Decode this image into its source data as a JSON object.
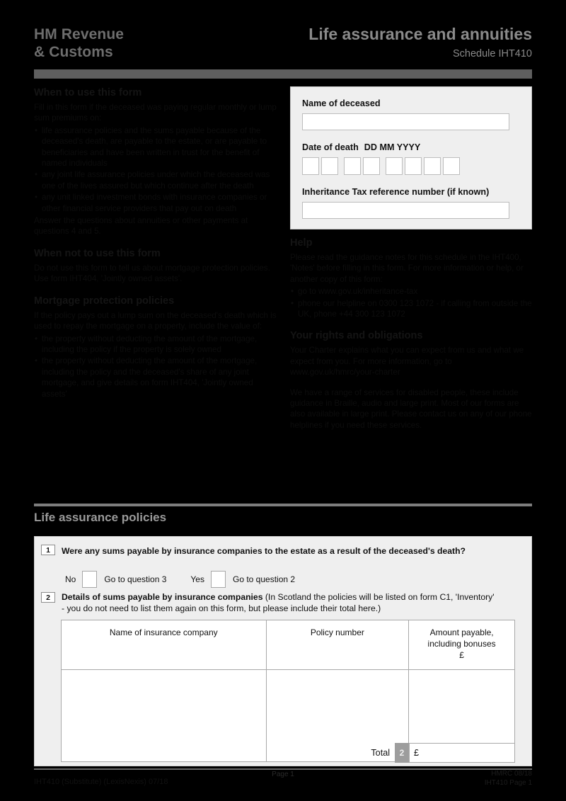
{
  "header": {
    "brand_line1": "HM Revenue",
    "brand_line2": "& Customs",
    "title": "Life assurance and annuities",
    "schedule": "Schedule IHT410"
  },
  "left_column": {
    "when_to_use": {
      "heading": "When to use this form",
      "intro": "Fill in this form if the deceased was paying regular monthly or lump sum premiums on:",
      "bullets": [
        "life assurance policies and the sums payable because of the deceased's death, are payable to the estate, or are payable to beneficiaries and have been written in trust for the benefit of named individuals",
        "any joint life assurance policies under which the deceased was one of the lives assured but which continue after the death",
        "any unit linked investment bonds with insurance companies or other financial service providers that pay out on death"
      ],
      "closing": "Answer the questions about annuities or other payments at questions 4 and 5."
    },
    "when_not_to_use": {
      "heading": "When not to use this form",
      "text": "Do not use this form to tell us about mortgage protection policies. Use form IHT404, 'Jointly owned assets'."
    },
    "mortgage": {
      "heading": "Mortgage protection policies",
      "intro": "If the policy pays out a lump sum on the deceased's death which is used to repay the mortgage on a property, include the value of:",
      "bullets": [
        "the property without deducting the amount of the mortgage, including the policy if the property is solely owned",
        "the property without deducting the amount of the mortgage, including the policy and the deceased's share of any joint mortgage, and give details on form IHT404, 'Jointly owned assets'"
      ]
    }
  },
  "right_column": {
    "help": {
      "heading": "Help",
      "intro": "Please read the guidance notes for this schedule in the IHT400, 'Notes' before filling in this form. For more information or help, or another copy of this form:",
      "bullets": [
        "go to www.gov.uk/inheritance-tax",
        "phone our helpline on 0300 123 1072 - if calling from outside the UK, phone +44 300 123 1072"
      ]
    },
    "rights": {
      "heading": "Your rights and obligations",
      "text": "Your Charter explains what you can expect from us and what we expect from you. For more information, go to www.gov.uk/hmrc/your-charter",
      "extra": "We have a range of services for disabled people, these include guidance in Braille, audio and large print. Most of our forms are also available in large print. Please contact us on any of our phone helplines if you need these services."
    }
  },
  "deceased_panel": {
    "name_label": "Name of deceased",
    "name_value": "",
    "date_label": "Date of death",
    "date_format": "DD MM YYYY",
    "date_digits": [
      "",
      "",
      "",
      "",
      "",
      "",
      "",
      ""
    ],
    "iht_ref_label": "Inheritance Tax reference number (if known)",
    "iht_ref_value": ""
  },
  "section": {
    "title": "Life assurance policies"
  },
  "question1": {
    "number": "1",
    "text": "Were any sums payable by insurance companies to the estate as a result of the deceased's death?",
    "no_label": "No",
    "no_goto": "Go to question 3",
    "yes_label": "Yes",
    "yes_goto": "Go to question 2"
  },
  "question2": {
    "number": "2",
    "bold_text": "Details of sums payable by insurance companies",
    "note_line1": "(In Scotland the policies will be listed on form C1, 'Inventory'",
    "note_line2": "- you do not need to list them again on this form, but please include their total here.)",
    "table": {
      "headers": [
        "Name of insurance company",
        "Policy number",
        "Amount payable,\nincluding bonuses\n£"
      ],
      "header_col3_line1": "Amount payable,",
      "header_col3_line2": "including bonuses",
      "header_col3_line3": "£",
      "rows": [
        [
          "",
          "",
          ""
        ]
      ]
    },
    "total_label": "Total",
    "total_badge": "2",
    "total_currency": "£",
    "total_value": ""
  },
  "footer": {
    "left": "IHT410 (Substitute) (LexisNexis) 07/18",
    "page": "Page 1",
    "right_line1": "HMRC 08/18",
    "right_line2": "IHT410 Page 1"
  },
  "colors": {
    "background": "#000000",
    "header_bar": "#5f5f5f",
    "panel_bg": "#efefef",
    "badge_gray": "#9d9d9d",
    "title_gray": "#8a8a8a"
  }
}
